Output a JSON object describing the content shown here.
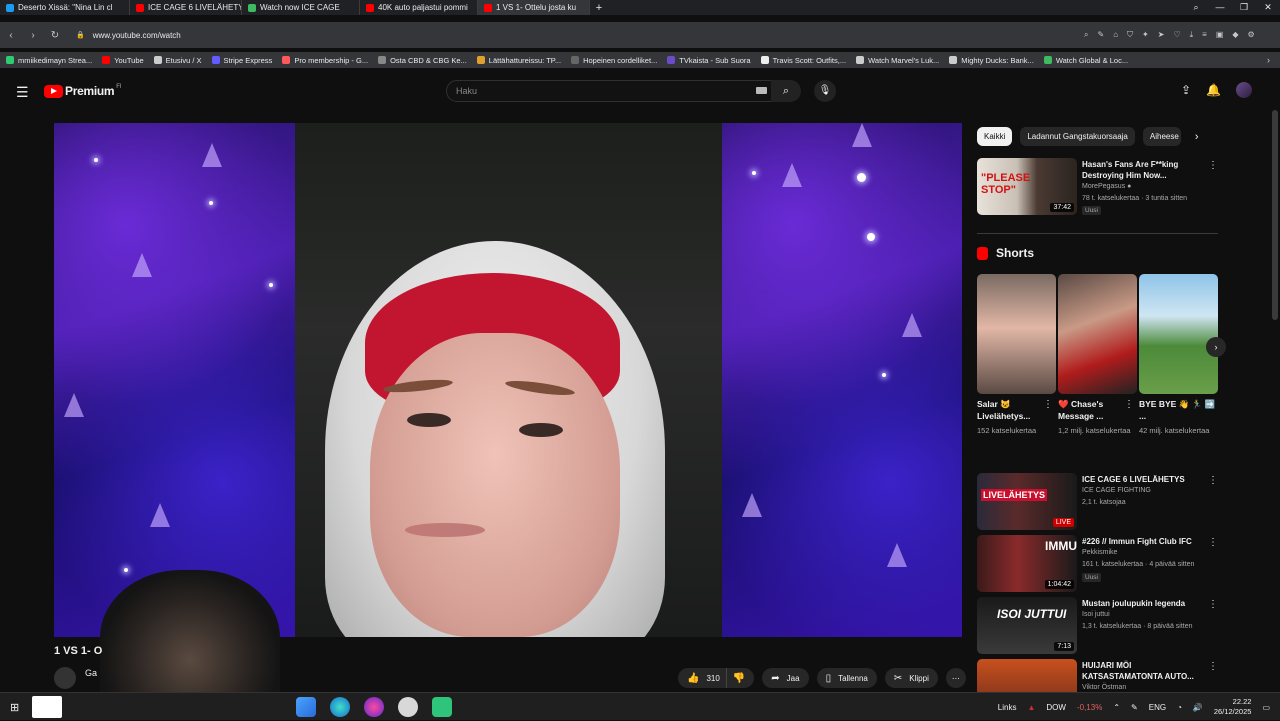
{
  "browser": {
    "tabs": [
      {
        "label": "Deserto Xissä: \"Nina Lin cl",
        "color": "#1d9bf0"
      },
      {
        "label": "ICE CAGE 6 LIVELÄHETYS",
        "color": "#ff0000"
      },
      {
        "label": "Watch now ICE CAGE",
        "color": "#3dbb61"
      },
      {
        "label": "40K auto paljastui pommi",
        "color": "#ff0000"
      },
      {
        "label": "1 VS 1- Ottelu josta ku",
        "color": "#ff0000"
      }
    ],
    "new_tab": "+",
    "url": "www.youtube.com/watch",
    "bookmarks": [
      {
        "label": "mmiikedimayn Strea...",
        "color": "#2ecc71"
      },
      {
        "label": "YouTube",
        "color": "#ff0000"
      },
      {
        "label": "Etusivu / X",
        "color": "#cccccc"
      },
      {
        "label": "Stripe Express",
        "color": "#635bff"
      },
      {
        "label": "Pro membership - G...",
        "color": "#ff5a5a"
      },
      {
        "label": "Osta CBD & CBG Ke...",
        "color": "#888888"
      },
      {
        "label": "Lättähattureissu: TP...",
        "color": "#e0a030"
      },
      {
        "label": "Hopeinen cordelliket...",
        "color": "#666666"
      },
      {
        "label": "TVkaista - Sub Suora",
        "color": "#6a4cc8"
      },
      {
        "label": "Travis Scott: Outfits,...",
        "color": "#eeeeee"
      },
      {
        "label": "Watch Marvel's Luk...",
        "color": "#cccccc"
      },
      {
        "label": "Mighty Ducks: Bank...",
        "color": "#cccccc"
      },
      {
        "label": "Watch Global & Loc...",
        "color": "#3dbb61"
      }
    ]
  },
  "header": {
    "logo_text": "Premium",
    "logo_sup": "FI",
    "search_placeholder": "Haku"
  },
  "video": {
    "title": "1 VS 1- O",
    "channel": "Ga",
    "like_count": "310",
    "share_label": "Jaa",
    "save_label": "Tallenna",
    "clip_label": "Klippi"
  },
  "sidebar": {
    "chips": [
      "Kaikki",
      "Ladannut Gangstakuorsaaja",
      "Aiheese"
    ],
    "recommendations": [
      {
        "title": "Hasan's Fans Are F**king Destroying Him Now...",
        "channel": "MorePegasus",
        "meta": "78 t. katselukertaa · 3 tuntia sitten",
        "badge": "Uusi",
        "duration": "37:42",
        "thumb_text": "\"PLEASE STOP\""
      },
      {
        "title": "ICE CAGE 6 LIVELÄHETYS",
        "channel": "ICE CAGE FIGHTING",
        "meta": "2,1 t. katsojaa",
        "badge": "",
        "duration": "LIVE",
        "thumb_text": "LIVELÄHETYS"
      },
      {
        "title": "#226 // Immun Fight Club IFC",
        "channel": "Pekkismike",
        "meta": "161 t. katselukertaa · 4 päivää sitten",
        "badge": "Uusi",
        "duration": "1:04:42",
        "thumb_text": "IMMU"
      },
      {
        "title": "Mustan joulupukin legenda",
        "channel": "Isoi juttui",
        "meta": "1,3 t. katselukertaa · 8 päivää sitten",
        "badge": "",
        "duration": "7:13",
        "thumb_text": "ISOI JUTTUI"
      },
      {
        "title": "HUIJARI MÖI KATSASTAMATONTA AUTO...",
        "channel": "Viktor Östman",
        "meta": "",
        "badge": "",
        "duration": "",
        "thumb_text": ""
      }
    ],
    "shorts_label": "Shorts",
    "shorts": [
      {
        "title": "Salar 😺 Livelähetys...",
        "views": "152 katselukertaa"
      },
      {
        "title": "❤️ Chase's Message ...",
        "views": "1,2 milj. katselukertaa"
      },
      {
        "title": "BYE BYE 👋 🏃‍♂️ ➡️ ...",
        "views": "42 milj. katselukertaa"
      }
    ]
  },
  "taskbar": {
    "links_label": "Links",
    "ticker": "DOW",
    "ticker_change": "-0,13%",
    "lang": "ENG",
    "time": "22.22",
    "date": "26/12/2025"
  }
}
